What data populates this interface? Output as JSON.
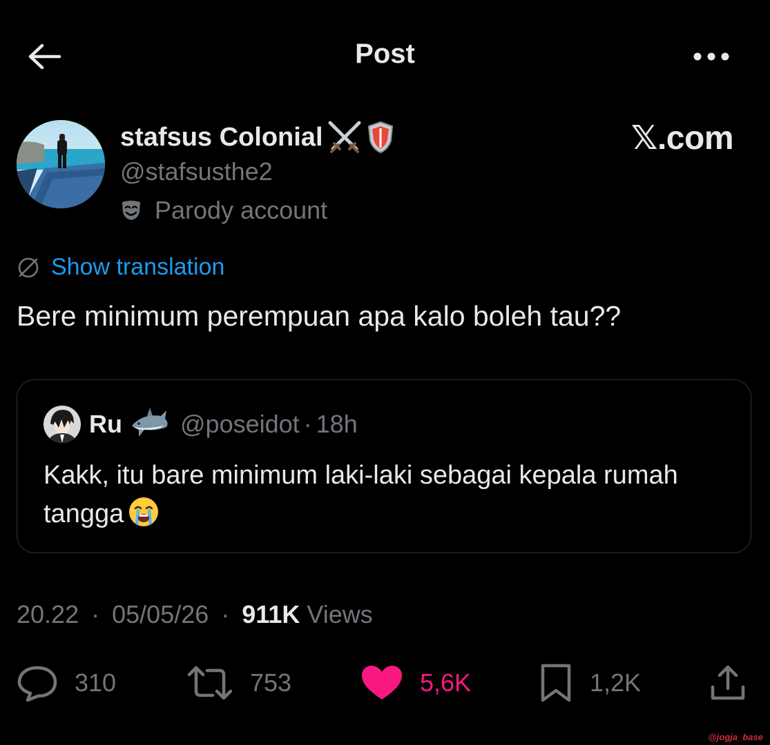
{
  "header": {
    "title": "Post",
    "back_icon": "arrow-left-icon",
    "more_icon": "more-horizontal-icon"
  },
  "author": {
    "display_name": "stafsus Colonial",
    "name_emojis": [
      "crossed-swords-icon",
      "shield-icon"
    ],
    "handle": "@stafsusthe2",
    "label": "Parody account",
    "label_icon": "theater-mask-icon"
  },
  "brand": {
    "text": "𝕏.com"
  },
  "translation": {
    "label": "Show translation",
    "icon": "globe-slash-icon",
    "color": "#1d9bf0"
  },
  "post": {
    "text": "Bere minimum perempuan apa kalo boleh tau??"
  },
  "quote": {
    "name": "Ru",
    "name_emoji": "shark-icon",
    "handle": "@poseidot",
    "dot": "·",
    "time": "18h",
    "text": "Kakk, itu bare minimum laki-laki sebagai kepala rumah tangga",
    "text_emoji": "loudly-crying-face-icon"
  },
  "meta": {
    "time": "20.22",
    "dot": "·",
    "date": "05/05/26",
    "views_count": "911K",
    "views_label": "Views"
  },
  "actions": {
    "replies": "310",
    "reposts": "753",
    "likes": "5,6K",
    "bookmarks": "1,2K",
    "like_color": "#f91880"
  },
  "watermark": "@jogja_base",
  "colors": {
    "background": "#000000",
    "text": "#e7e9ea",
    "muted": "#71767b",
    "border": "#2f3336"
  }
}
